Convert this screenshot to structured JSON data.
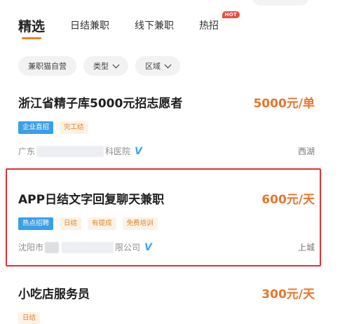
{
  "tabs": [
    {
      "label": "精选",
      "active": true
    },
    {
      "label": "日结兼职",
      "active": false
    },
    {
      "label": "线下兼职",
      "active": false
    },
    {
      "label": "热招",
      "active": false,
      "badge": "HOT"
    }
  ],
  "filters": [
    {
      "label": "兼职猫自营",
      "has_dropdown": false
    },
    {
      "label": "类型",
      "has_dropdown": true
    },
    {
      "label": "区域",
      "has_dropdown": true
    }
  ],
  "jobs": [
    {
      "title": "浙江省精子库5000元招志愿者",
      "pay": "5000元/单",
      "tags": [
        {
          "label": "企业直招",
          "style": "blue"
        },
        {
          "label": "完工结",
          "style": "plain"
        }
      ],
      "company_prefix": "广东",
      "company_suffix": "科医院",
      "verified_icon": "verified-v-icon",
      "district": "西湖"
    },
    {
      "title": "APP日结文字回复聊天兼职",
      "pay": "600元/天",
      "tags": [
        {
          "label": "热点招聘",
          "style": "blue"
        },
        {
          "label": "日结",
          "style": "plain"
        },
        {
          "label": "有提成",
          "style": "plain"
        },
        {
          "label": "免费培训",
          "style": "plain"
        }
      ],
      "company_prefix": "沈阳市",
      "company_suffix": "限公司",
      "verified_icon": "verified-v-icon",
      "district": "上城"
    },
    {
      "title": "小吃店服务员",
      "pay": "300元/天",
      "tags": [
        {
          "label": "日结",
          "style": "plain"
        }
      ]
    }
  ],
  "colors": {
    "accent": "#f0802a",
    "pay": "#e8762a",
    "tag_blue": "#3b9fe8",
    "highlight_border": "#e03232"
  }
}
